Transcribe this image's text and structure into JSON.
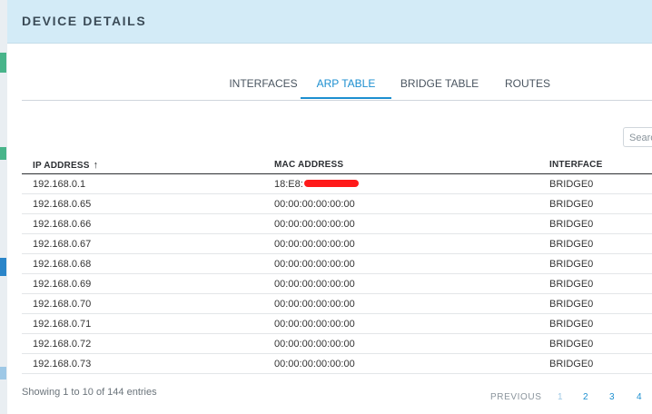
{
  "dialog": {
    "title": "DEVICE DETAILS"
  },
  "tabs": [
    {
      "label": "INTERFACES",
      "active": false
    },
    {
      "label": "ARP TABLE",
      "active": true
    },
    {
      "label": "BRIDGE TABLE",
      "active": false
    },
    {
      "label": "ROUTES",
      "active": false
    }
  ],
  "search": {
    "placeholder": "Search"
  },
  "table": {
    "columns": [
      "IP ADDRESS",
      "MAC ADDRESS",
      "INTERFACE"
    ],
    "sort_icon": "arrow-up-icon",
    "rows": [
      {
        "ip": "192.168.0.1",
        "mac": "18:E8:",
        "interface": "BRIDGE0",
        "redacted": true
      },
      {
        "ip": "192.168.0.65",
        "mac": "00:00:00:00:00:00",
        "interface": "BRIDGE0"
      },
      {
        "ip": "192.168.0.66",
        "mac": "00:00:00:00:00:00",
        "interface": "BRIDGE0"
      },
      {
        "ip": "192.168.0.67",
        "mac": "00:00:00:00:00:00",
        "interface": "BRIDGE0"
      },
      {
        "ip": "192.168.0.68",
        "mac": "00:00:00:00:00:00",
        "interface": "BRIDGE0"
      },
      {
        "ip": "192.168.0.69",
        "mac": "00:00:00:00:00:00",
        "interface": "BRIDGE0"
      },
      {
        "ip": "192.168.0.70",
        "mac": "00:00:00:00:00:00",
        "interface": "BRIDGE0"
      },
      {
        "ip": "192.168.0.71",
        "mac": "00:00:00:00:00:00",
        "interface": "BRIDGE0"
      },
      {
        "ip": "192.168.0.72",
        "mac": "00:00:00:00:00:00",
        "interface": "BRIDGE0"
      },
      {
        "ip": "192.168.0.73",
        "mac": "00:00:00:00:00:00",
        "interface": "BRIDGE0"
      }
    ]
  },
  "footer": {
    "entries_text": "Showing 1 to 10 of 144 entries",
    "pagination": {
      "previous": "PREVIOUS",
      "pages": [
        "1",
        "2",
        "3",
        "4"
      ],
      "current": "1"
    }
  },
  "colors": {
    "accent": "#1c8fd0",
    "header_bg": "#d3ebf7",
    "redaction": "#ff1a1a"
  }
}
